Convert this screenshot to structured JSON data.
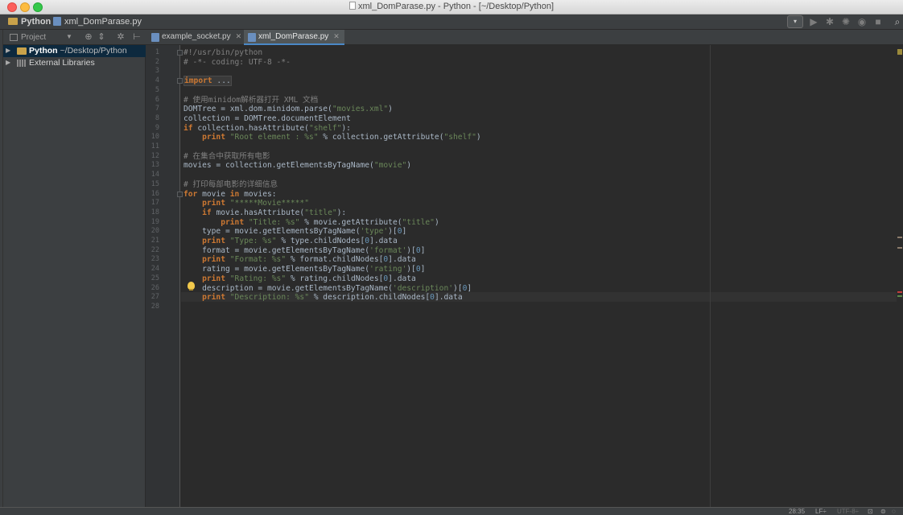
{
  "window": {
    "title": "xml_DomParase.py - Python - [~/Desktop/Python]"
  },
  "navbar": {
    "project": "Python",
    "file": "xml_DomParase.py"
  },
  "project_panel": {
    "label": "Project",
    "tree": [
      {
        "name": "Python",
        "path": "~/Desktop/Python",
        "selected": true
      },
      {
        "name": "External Libraries",
        "path": "",
        "selected": false
      }
    ]
  },
  "tabs": [
    {
      "label": "example_socket.py",
      "active": false
    },
    {
      "label": "xml_DomParase.py",
      "active": true
    }
  ],
  "editor": {
    "line_numbers": [
      "1",
      "2",
      "3",
      "4",
      "5",
      "6",
      "7",
      "8",
      "9",
      "10",
      "11",
      "12",
      "13",
      "14",
      "15",
      "16",
      "17",
      "18",
      "19",
      "20",
      "21",
      "22",
      "23",
      "24",
      "25",
      "26",
      "27",
      "28"
    ],
    "lines": [
      "#!/usr/bin/python",
      "# -*- coding: UTF-8 -*-",
      "",
      "import ...",
      "",
      "# 使用minidom解析器打开 XML 文档",
      "DOMTree = xml.dom.minidom.parse(\"movies.xml\")",
      "collection = DOMTree.documentElement",
      "if collection.hasAttribute(\"shelf\"):",
      "    print \"Root element : %s\" % collection.getAttribute(\"shelf\")",
      "",
      "# 在集合中获取所有电影",
      "movies = collection.getElementsByTagName(\"movie\")",
      "",
      "# 打印每部电影的详细信息",
      "for movie in movies:",
      "    print \"*****Movie*****\"",
      "    if movie.hasAttribute(\"title\"):",
      "        print \"Title: %s\" % movie.getAttribute(\"title\")",
      "    type = movie.getElementsByTagName('type')[0]",
      "    print \"Type: %s\" % type.childNodes[0].data",
      "    format = movie.getElementsByTagName('format')[0]",
      "    print \"Format: %s\" % format.childNodes[0].data",
      "    rating = movie.getElementsByTagName('rating')[0]",
      "    print \"Rating: %s\" % rating.childNodes[0].data",
      "    description = movie.getElementsByTagName('description')[0]",
      "    print \"Description: %s\" % description.childNodes[0].data",
      ""
    ]
  },
  "statusbar": {
    "position": "28:35",
    "line_sep": "LF÷",
    "encoding": "UTF-8÷"
  },
  "colors": {
    "keyword": "#cc7832",
    "string": "#6a8759",
    "comment": "#808080",
    "number": "#6897bb",
    "text": "#a9b7c6",
    "background": "#2b2b2b"
  }
}
